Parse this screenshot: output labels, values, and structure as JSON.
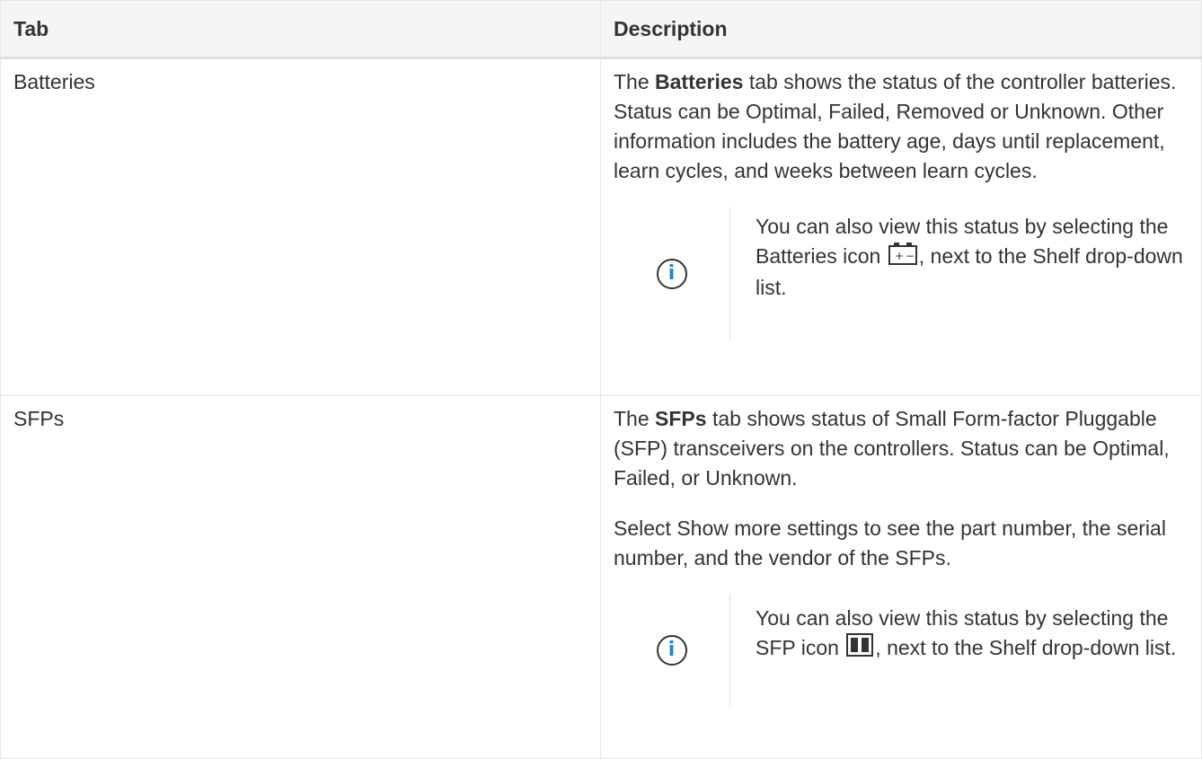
{
  "table": {
    "headers": {
      "tab": "Tab",
      "description": "Description"
    },
    "rows": [
      {
        "tab": "Batteries",
        "desc_prefix": "The ",
        "desc_bold": "Batteries",
        "desc_rest": " tab shows the status of the controller batteries. Status can be Optimal, Failed, Removed or Unknown. Other information includes the battery age, days until replacement, learn cycles, and weeks between learn cycles.",
        "note_before_icon": "You can also view this status by selecting the Batteries icon ",
        "note_after_icon": ", next to the Shelf drop-down list.",
        "note_icon": "battery-icon"
      },
      {
        "tab": "SFPs",
        "desc_prefix": "The ",
        "desc_bold": "SFPs",
        "desc_rest": " tab shows status of Small Form-factor Pluggable (SFP) transceivers on the controllers. Status can be Optimal, Failed, or Unknown.",
        "desc_para2": "Select Show more settings to see the part number, the serial number, and the vendor of the SFPs.",
        "note_before_icon": "You can also view this status by selecting the SFP icon ",
        "note_after_icon": ", next to the Shelf drop-down list.",
        "note_icon": "sfp-icon"
      }
    ]
  },
  "colors": {
    "header_bg": "#f5f5f5",
    "text": "#333333",
    "info_accent": "#1a8ad4",
    "border": "#e6e6e6"
  }
}
